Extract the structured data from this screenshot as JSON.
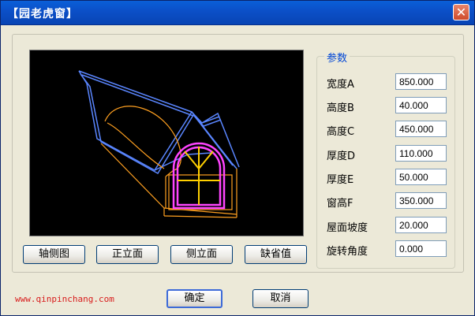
{
  "window": {
    "title": "【园老虎窗】"
  },
  "preview": {
    "label": ""
  },
  "view_buttons": [
    {
      "label": "轴侧图"
    },
    {
      "label": "正立面"
    },
    {
      "label": "侧立面"
    },
    {
      "label": "缺省值"
    }
  ],
  "params": {
    "group_title": "参数",
    "items": [
      {
        "label": "宽度A",
        "value": "850.000"
      },
      {
        "label": "高度B",
        "value": "40.000"
      },
      {
        "label": "高度C",
        "value": "450.000"
      },
      {
        "label": "厚度D",
        "value": "110.000"
      },
      {
        "label": "厚度E",
        "value": "50.000"
      },
      {
        "label": "窗高F",
        "value": "350.000"
      },
      {
        "label": "屋面坡度",
        "value": "20.000"
      },
      {
        "label": "旋转角度",
        "value": "0.000"
      }
    ]
  },
  "footer": {
    "url": "www.qinpinchang.com",
    "ok_label": "确定",
    "cancel_label": "取消"
  },
  "colors": {
    "roof": "#5a86ff",
    "arch": "#ff44ff",
    "wall": "#ffa020",
    "mullion": "#ffd000"
  }
}
